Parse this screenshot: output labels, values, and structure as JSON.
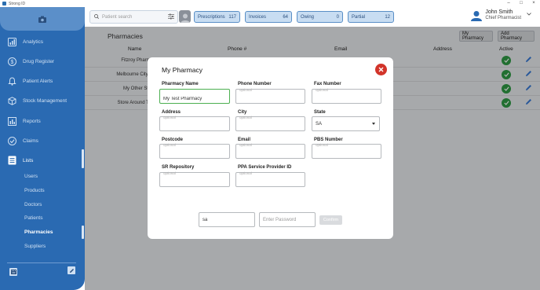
{
  "window": {
    "title": "Strong ID"
  },
  "sidebar": {
    "items": [
      {
        "label": "Analytics",
        "icon": "analytics-icon"
      },
      {
        "label": "Drug Register",
        "icon": "drug-register-icon"
      },
      {
        "label": "Patient Alerts",
        "icon": "bell-icon"
      },
      {
        "label": "Stock Management",
        "icon": "box-icon"
      },
      {
        "label": "Reports",
        "icon": "bar-chart-icon"
      },
      {
        "label": "Claims",
        "icon": "check-circle-icon"
      },
      {
        "label": "Lists",
        "icon": "list-icon"
      }
    ],
    "subitems": [
      "Users",
      "Products",
      "Doctors",
      "Patients",
      "Pharmacies",
      "Suppliers"
    ],
    "active": "Pharmacies"
  },
  "topbar": {
    "search_placeholder": "Patient search",
    "buttons": [
      {
        "label": "Prescriptions",
        "count": "117"
      },
      {
        "label": "Invoices",
        "count": "64"
      },
      {
        "label": "Owing",
        "count": "0"
      },
      {
        "label": "Partial",
        "count": "12"
      }
    ],
    "user": {
      "name": "John Smith",
      "role": "Chief Pharmacist"
    }
  },
  "page": {
    "title": "Pharmacies",
    "btn_my_pharmacy": "My Pharmacy",
    "btn_add_pharmacy": "Add Pharmacy",
    "columns": [
      "Name",
      "Phone #",
      "Email",
      "Address",
      "Active"
    ],
    "rows": [
      {
        "name": "Fitzroy Pharm"
      },
      {
        "name": "Melbourne City Ph"
      },
      {
        "name": "My Other St"
      },
      {
        "name": "Store Around The"
      }
    ]
  },
  "modal": {
    "title": "My Pharmacy",
    "fields": {
      "pharmacy_name": {
        "label": "Pharmacy Name",
        "value": "My Test Pharmacy"
      },
      "phone": {
        "label": "Phone Number",
        "hint": "optional"
      },
      "fax": {
        "label": "Fax Number",
        "hint": "optional"
      },
      "address": {
        "label": "Address",
        "hint": "optional"
      },
      "city": {
        "label": "City",
        "hint": "optional"
      },
      "state": {
        "label": "State",
        "value": "SA"
      },
      "postcode": {
        "label": "Postcode",
        "hint": "optional"
      },
      "email": {
        "label": "Email",
        "hint": "optional"
      },
      "pbs": {
        "label": "PBS Number",
        "hint": "optional"
      },
      "sr_repo": {
        "label": "SR Repository",
        "hint": "optional"
      },
      "ppa": {
        "label": "PPA Service Provider ID",
        "hint": "optional"
      }
    },
    "auth": {
      "username": "sa",
      "password_placeholder": "Enter Password",
      "confirm": "Confirm"
    }
  }
}
